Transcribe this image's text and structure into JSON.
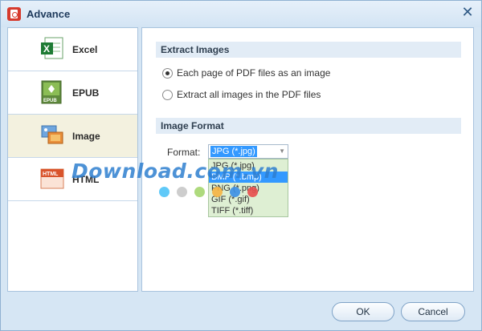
{
  "window": {
    "title": "Advance",
    "close_glyph": "✕"
  },
  "sidebar": {
    "items": [
      {
        "label": "Excel",
        "icon": "excel-icon",
        "active": false
      },
      {
        "label": "EPUB",
        "icon": "epub-icon",
        "active": false
      },
      {
        "label": "Image",
        "icon": "image-icon",
        "active": true
      },
      {
        "label": "HTML",
        "icon": "html-icon",
        "active": false
      }
    ]
  },
  "main": {
    "extract": {
      "header": "Extract Images",
      "options": [
        {
          "label": "Each page of PDF files as an image",
          "checked": true
        },
        {
          "label": "Extract all images in the PDF files",
          "checked": false
        }
      ]
    },
    "format": {
      "header": "Image Format",
      "label": "Format:",
      "selected": "JPG (*.jpg)",
      "options": [
        "JPG (*.jpg)",
        "BMP (*.bmp)",
        "PNG (*.png)",
        "GIF (*.gif)",
        "TIFF (*.tiff)"
      ],
      "highlighted_index": 1
    }
  },
  "watermark": {
    "text": "Download.com.vn",
    "dot_colors": [
      "#4fc3f7",
      "#c8c8c8",
      "#a5d66f",
      "#f5b342",
      "#3a8ee6",
      "#e84c4c"
    ]
  },
  "footer": {
    "ok_label": "OK",
    "cancel_label": "Cancel"
  },
  "colors": {
    "accent": "#3399ff",
    "title_bar": "#d3e4f4",
    "active_item": "#f3f1df",
    "section_header": "#e2ecf6"
  }
}
